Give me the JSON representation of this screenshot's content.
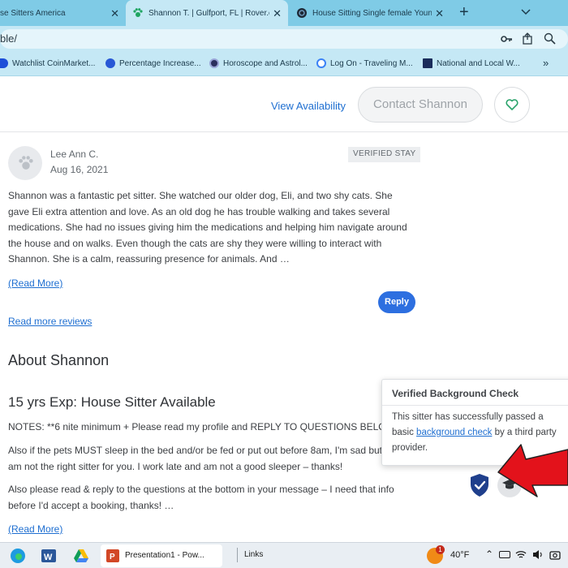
{
  "browser": {
    "tabs": [
      {
        "title": "se Sitters America",
        "active": false
      },
      {
        "title": "Shannon T. | Gulfport, FL | Rover.c",
        "active": true
      },
      {
        "title": "House Sitting Single female Youn",
        "active": false
      }
    ],
    "new_tab": "+",
    "url": "ble/",
    "bookmarks": [
      "Watchlist CoinMarket...",
      "Percentage Increase...",
      "Horoscope and Astrol...",
      "Log On - Traveling M...",
      "National and Local W..."
    ],
    "bookmarks_more": "»"
  },
  "header": {
    "view_availability": "View Availability",
    "contact_button": "Contact Shannon"
  },
  "review": {
    "author": "Lee Ann C.",
    "date": "Aug 16, 2021",
    "badge": "VERIFIED STAY",
    "text": "Shannon was a fantastic pet sitter. She watched our older dog, Eli, and two shy cats. She gave Eli extra attention and love. As an old dog he has trouble walking and takes several medications. She had no issues giving him the medications and helping him navigate around the house and on walks. Even though the cats are shy they were willing to interact with Shannon. She is a calm, reassuring presence for animals. And …",
    "read_more": "(Read More)",
    "reply": "Reply"
  },
  "read_more_reviews": "Read more reviews",
  "about": {
    "heading": "About Shannon",
    "title": "15 yrs Exp: House Sitter Available",
    "paragraphs": [
      "NOTES: **6 nite minimum + Please read my profile and REPLY TO QUESTIONS BELOW",
      "Also if the pets MUST sleep in the bed and/or be fed or put out before 8am, I'm sad but I am not the right sitter for you. I work late and am not a good sleeper – thanks!",
      "Also please read & reply to the questions at the bottom in your message – I need that info before I'd accept a booking, thanks! …"
    ],
    "read_more": "(Read More)"
  },
  "popup": {
    "title": "Verified Background Check",
    "text_before": "This sitter has successfully passed a basic ",
    "link": "background check",
    "text_after": " by a third party provider."
  },
  "taskbar": {
    "app_label": "Presentation1 - Pow...",
    "links": "Links",
    "temperature": "40°F",
    "weather_badge": "1"
  },
  "colors": {
    "tabbar": "#7fcbe6",
    "link": "#1f6fd1",
    "reply_button": "#2d6fe0",
    "shield": "#1f3f8c",
    "arrow": "#e3121b"
  },
  "icons": [
    "paw-icon",
    "heart-icon",
    "shield-check-icon",
    "graduation-cap-icon",
    "key-icon",
    "share-icon",
    "zoom-icon"
  ]
}
